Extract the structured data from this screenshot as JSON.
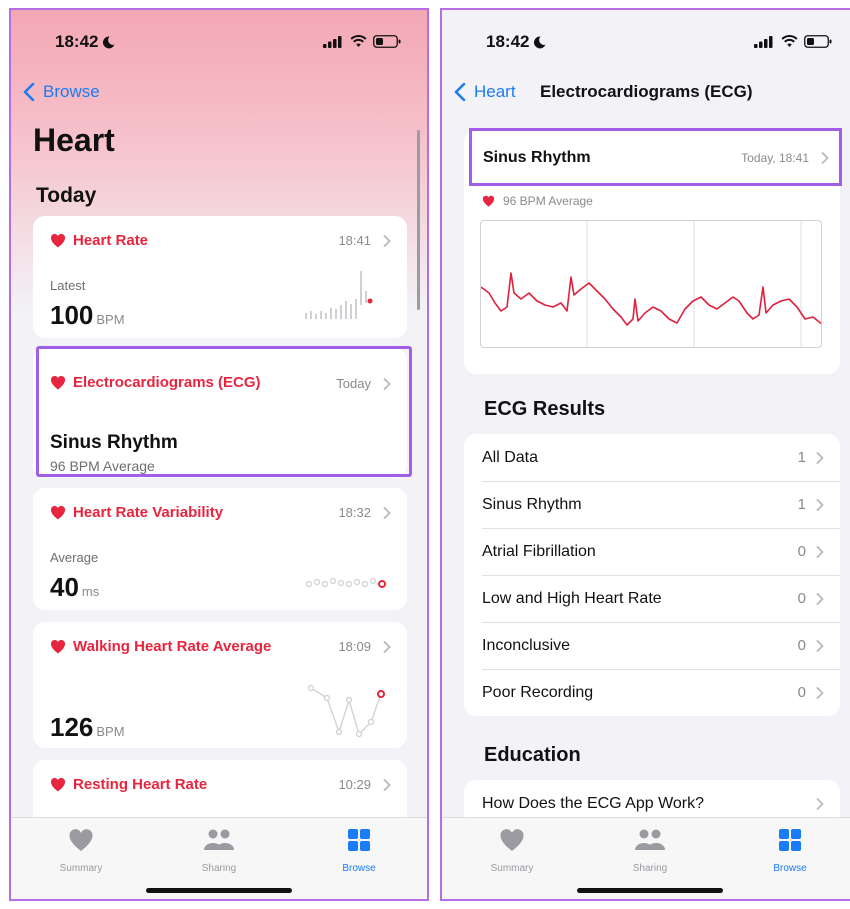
{
  "colors": {
    "accent": "#1a7cf6",
    "heart": "#e8253f",
    "highlight": "#a15ee6"
  },
  "status_bar": {
    "time": "18:42"
  },
  "left_screen": {
    "back_label": "Browse",
    "title": "Heart",
    "section": "Today",
    "cards": [
      {
        "title": "Heart Rate",
        "time": "18:41",
        "label": "Latest",
        "value": "100",
        "unit": "BPM"
      },
      {
        "title": "Electrocardiograms (ECG)",
        "time": "Today",
        "result": "Sinus Rhythm",
        "subtitle": "96 BPM Average"
      },
      {
        "title": "Heart Rate Variability",
        "time": "18:32",
        "label": "Average",
        "value": "40",
        "unit": "ms"
      },
      {
        "title": "Walking Heart Rate Average",
        "time": "18:09",
        "value": "126",
        "unit": "BPM"
      },
      {
        "title": "Resting Heart Rate",
        "time": "10:29"
      }
    ]
  },
  "right_screen": {
    "back_label": "Heart",
    "nav_title": "Electrocardiograms (ECG)",
    "ecg": {
      "result": "Sinus Rhythm",
      "time": "Today, 18:41",
      "average": "96 BPM Average"
    },
    "results_header": "ECG Results",
    "results": [
      {
        "label": "All Data",
        "count": "1"
      },
      {
        "label": "Sinus Rhythm",
        "count": "1"
      },
      {
        "label": "Atrial Fibrillation",
        "count": "0"
      },
      {
        "label": "Low and High Heart Rate",
        "count": "0"
      },
      {
        "label": "Inconclusive",
        "count": "0"
      },
      {
        "label": "Poor Recording",
        "count": "0"
      }
    ],
    "education_header": "Education",
    "education": [
      {
        "label": "How Does the ECG App Work?"
      }
    ]
  },
  "tabbar": {
    "tabs": [
      {
        "label": "Summary",
        "icon": "heart-icon"
      },
      {
        "label": "Sharing",
        "icon": "people-icon"
      },
      {
        "label": "Browse",
        "icon": "grid-icon",
        "active": true
      }
    ]
  }
}
